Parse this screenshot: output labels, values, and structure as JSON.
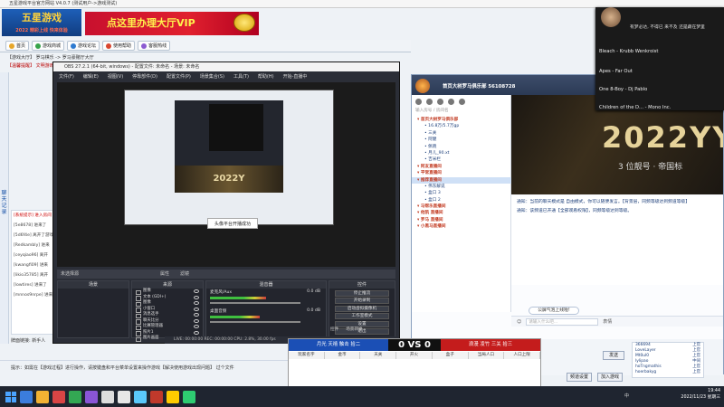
{
  "bgwin": {
    "title": "五星游戏平台官方网站 V4.0.7 (测试用户->游戏测试)",
    "logo_text": "五星游戏",
    "logo_sub": "2022 精彩上线  快来体验",
    "vip_text": "点这里办理大厅VIP",
    "nav": [
      "首页",
      "游戏商城",
      "游戏论坛",
      "使用帮助",
      "客服热线"
    ],
    "crumb": "【游戏大厅】 罗马棋乐 -> 罗马豪赌厅大厅",
    "notice": "【温馨提醒】 文明游戏, 健康娱乐, 请勿沉迷...",
    "side_label": "聊天记录",
    "log_title": "[系统提示] 进入房间",
    "log_lines": [
      "[5e8678] 进来了",
      "[5d6f4e] 离开了游戏",
      "[Redkambly] 进来",
      "[ceyqiao96] 离开",
      "[kwangfi09] 进来",
      "[likio35785] 离开",
      "[lowtires] 进来了",
      "[mnnos9nrpe] 进来"
    ],
    "status_label": "牌面链接:",
    "status_value": "新手人",
    "hint": "提示：如需在【游戏过程】进行操作，请按键盘和平台菜单设置来操作游戏【解决使用游戏出现问题】 过个文件"
  },
  "obs": {
    "title": "OBS 27.2.1 (64-bit, windows) - 配置文件: 未命名 - 场景: 未命名",
    "menu": [
      "文件(F)",
      "编辑(E)",
      "视图(V)",
      "停靠部件(D)",
      "配置文件(P)",
      "场景集合(S)",
      "工具(T)",
      "帮助(H)",
      "开始-直播中"
    ],
    "preview_banner": "2022Y",
    "preview_toast": "头像平台开播成功",
    "scene_header": "未选择源",
    "radio_props": "属性",
    "radio_filters": "滤镜",
    "panels": {
      "scenes": "场景",
      "sources": "来源",
      "mixer": "混音器",
      "controls": "控件"
    },
    "sources": [
      "图像",
      "文本 (GDI+)",
      "图像",
      "小窗口",
      "消息选手",
      "聊天比分",
      "比赛管理器",
      "照片1",
      "图片画面"
    ],
    "mixer": [
      {
        "name": "麦克风/Aux",
        "db": "0.0 dB",
        "level": 0.62
      },
      {
        "name": "桌面音频",
        "db": "0.0 dB",
        "level": 0.55
      }
    ],
    "controls": [
      "停止推流",
      "开始录制",
      "启动虚拟摄像机",
      "工作室模式",
      "设置",
      "退出"
    ],
    "bottom_tabs": [
      "控件",
      "场景转换"
    ],
    "status": "LIVE: 00:00:00   REC: 00:00:00   CPU: 2.8%, 30.00 fps"
  },
  "chat": {
    "title": "首页大树罗马俱乐部",
    "uid": "56108728",
    "icons": [
      "user-count-icon",
      "info-icon",
      "phone-icon",
      "star-icon",
      "menu-icon"
    ],
    "search": "输入房号 / 房间名",
    "tree": [
      {
        "label": "首页大树罗马俱乐部",
        "level": 1
      },
      {
        "label": "16.8万/5.7万gp",
        "level": 2
      },
      {
        "label": "三关",
        "level": 2
      },
      {
        "label": "阿健",
        "level": 2
      },
      {
        "label": "佩晓",
        "level": 2
      },
      {
        "label": "月儿_90.xt",
        "level": 2
      },
      {
        "label": "吉米栏",
        "level": 2
      },
      {
        "label": "阿友直播间",
        "level": 1
      },
      {
        "label": "平常直播间",
        "level": 1
      },
      {
        "label": "推荐直播间",
        "level": 1,
        "selected": true
      },
      {
        "label": "伟东解说",
        "level": 2
      },
      {
        "label": "盒口 3",
        "level": 2
      },
      {
        "label": "盒口 2",
        "level": 2
      },
      {
        "label": "马帮乐直播间",
        "level": 1
      },
      {
        "label": "他凯 直播间",
        "level": 1
      },
      {
        "label": "罗马 直播间",
        "level": 1
      },
      {
        "label": "小黑马直播间",
        "level": 1
      }
    ],
    "banner_text": "2022YY",
    "banner_sub": "3 位靓号 · 帝国标",
    "messages": [
      "通知：当前的聊天模式是 自由模式，你可以随便发言。【背景层，同频等级达到频道等级】",
      "通知：该频道已开通【全部观看权限】，同频等级达到等级。"
    ],
    "pill": "公屏气泡上线啦!",
    "input_placeholder": "请输入什么吧...",
    "input_label": "表情",
    "send": "发送",
    "settings": "频道设置",
    "join": "加入游戏",
    "users": [
      {
        "name": "366694",
        "role": "上官"
      },
      {
        "name": "LoveLayer",
        "role": "上官"
      },
      {
        "name": "Mt0ul0",
        "role": "上官"
      },
      {
        "name": "lylipao",
        "role": "中间"
      },
      {
        "name": "hoTngmathis",
        "role": "上官"
      },
      {
        "name": "hoerbakyg",
        "role": "上官"
      }
    ]
  },
  "score": {
    "left": "月光 天禧 触击 拾二",
    "left_score": "0",
    "vs": "VS",
    "right_score": "0",
    "right": "浪漫 凌竹 三关 拾三",
    "columns": [
      "玩家名字",
      "金币",
      "天关",
      "开火",
      "盒子",
      "当局人口",
      "人口上限"
    ]
  },
  "music": {
    "header": "有梦必达, 不得已 来不及 还是藏在梦里",
    "items": [
      "Bleach - Krubb Wenkroist",
      "Apes - Far Out",
      "One 8-Boy - Dj Pablo",
      "Children of the D... - Mono Inc."
    ]
  },
  "taskbar": {
    "time": "19:44",
    "date": "2022/11/23 星期三",
    "tray": "中",
    "app_colors": [
      "#3b7ddd",
      "#f2b233",
      "#d94545",
      "#33a853",
      "#8a55d6",
      "#ddd",
      "#e7e7e7",
      "#5ac8fa",
      "#c0392b",
      "#ffcc00",
      "#2ecc71"
    ]
  }
}
